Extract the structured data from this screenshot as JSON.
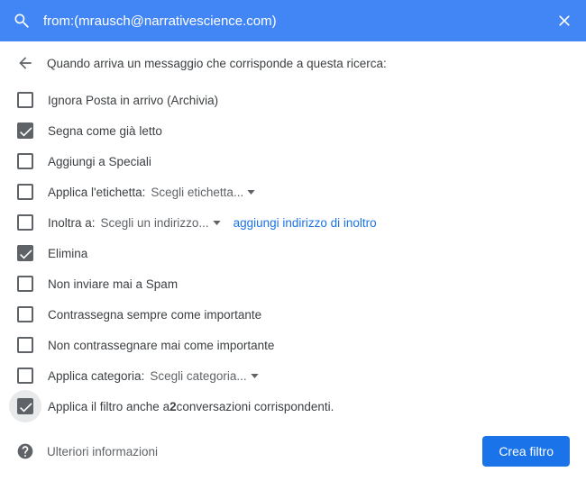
{
  "header": {
    "search_query": "from:(mrausch@narrativescience.com)"
  },
  "intro": "Quando arriva un messaggio che corrisponde a questa ricerca:",
  "options": {
    "skip_inbox": "Ignora Posta in arrivo (Archivia)",
    "mark_read": "Segna come già letto",
    "star": "Aggiungi a Speciali",
    "apply_label_prefix": "Applica l'etichetta:",
    "apply_label_dropdown": "Scegli etichetta...",
    "forward_prefix": "Inoltra a:",
    "forward_dropdown": "Scegli un indirizzo...",
    "forward_link": "aggiungi indirizzo di inoltro",
    "delete": "Elimina",
    "never_spam": "Non inviare mai a Spam",
    "always_important": "Contrassegna sempre come importante",
    "never_important": "Non contrassegnare mai come importante",
    "category_prefix": "Applica categoria:",
    "category_dropdown": "Scegli categoria...",
    "also_apply_prefix": "Applica il filtro anche a ",
    "also_apply_count": "2",
    "also_apply_suffix": " conversazioni corrispondenti."
  },
  "footer": {
    "more_info": "Ulteriori informazioni",
    "create_button": "Crea filtro"
  }
}
